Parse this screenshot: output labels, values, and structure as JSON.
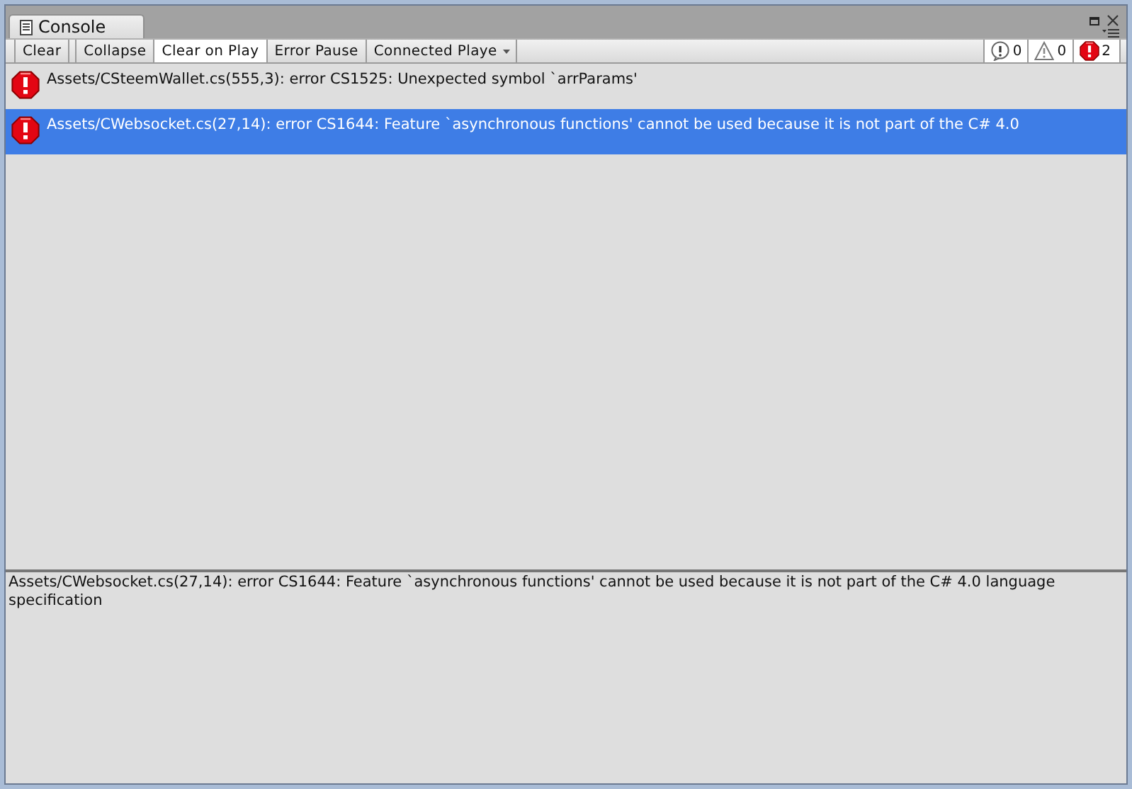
{
  "tab": {
    "title": "Console"
  },
  "toolbar": [
    {
      "label": "Clear",
      "kind": "button",
      "selected": false
    },
    {
      "label": "Collapse",
      "kind": "toggle",
      "selected": false
    },
    {
      "label": "Clear on Play",
      "kind": "toggle",
      "selected": true
    },
    {
      "label": "Error Pause",
      "kind": "toggle",
      "selected": false
    },
    {
      "label": "Connected Playe",
      "kind": "dropdown",
      "selected": false
    }
  ],
  "counters": [
    {
      "kind": "info",
      "count": "0",
      "selected": true
    },
    {
      "kind": "warning",
      "count": "0",
      "selected": true
    },
    {
      "kind": "error",
      "count": "2",
      "selected": true
    }
  ],
  "entries": [
    {
      "kind": "error",
      "text": "Assets/CSteemWallet.cs(555,3): error CS1525: Unexpected symbol `arrParams'",
      "selected": false
    },
    {
      "kind": "error",
      "text": "Assets/CWebsocket.cs(27,14): error CS1644: Feature `asynchronous functions' cannot be used because it is not part of the C# 4.0",
      "selected": true
    }
  ],
  "detail": {
    "text": "Assets/CWebsocket.cs(27,14): error CS1644: Feature `asynchronous functions' cannot be used because it is not part of the C# 4.0 language specification"
  }
}
